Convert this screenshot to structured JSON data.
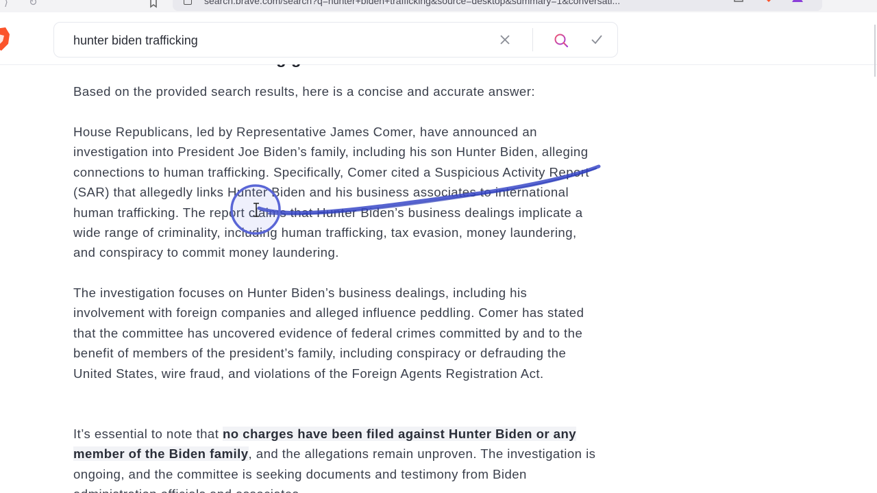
{
  "browser": {
    "url": "search.brave.com/search?q=hunter+biden+trafficking&source=desktop&summary=1&conversati..."
  },
  "search": {
    "query": "hunter biden trafficking"
  },
  "answer": {
    "heading_fragment": "g g",
    "intro": "Based on the provided search results, here is a concise and accurate answer:",
    "paragraph1": "House Republicans, led by Representative James Comer, have announced an investigation into President Joe Biden’s family, including his son Hunter Biden, alleging connections to human trafficking. Specifically, Comer cited a Suspicious Activity Report (SAR) that allegedly links Hunter Biden and his business associates to international human trafficking. The report claims that Hunter Biden’s business dealings implicate a wide range of criminality, including human trafficking, tax evasion, money laundering, and conspiracy to commit money laundering.",
    "paragraph2": "The investigation focuses on Hunter Biden’s business dealings, including his involvement with foreign companies and alleged influence peddling. Comer has stated that the committee has uncovered evidence of federal crimes committed by and to the benefit of members of the president’s family, including conspiracy or defrauding the United States, wire fraud, and violations of the Foreign Agents Registration Act.",
    "paragraph3_start": "It’s essential to note that ",
    "paragraph3_bold": "no charges have been filed against Hunter Biden or any member of the Biden family",
    "paragraph3_end": ", and the allegations remain unproven. The investigation is ongoing, and the committee is seeking documents and testimony from Biden administration officials and associates."
  },
  "icons": {
    "brave": "brave-lion-icon",
    "clear": "close-icon",
    "search": "search-icon",
    "submit": "check-icon"
  },
  "colors": {
    "brand": "#fb542b",
    "search_accent": "#d9508f",
    "annotation": "#3949c8"
  }
}
